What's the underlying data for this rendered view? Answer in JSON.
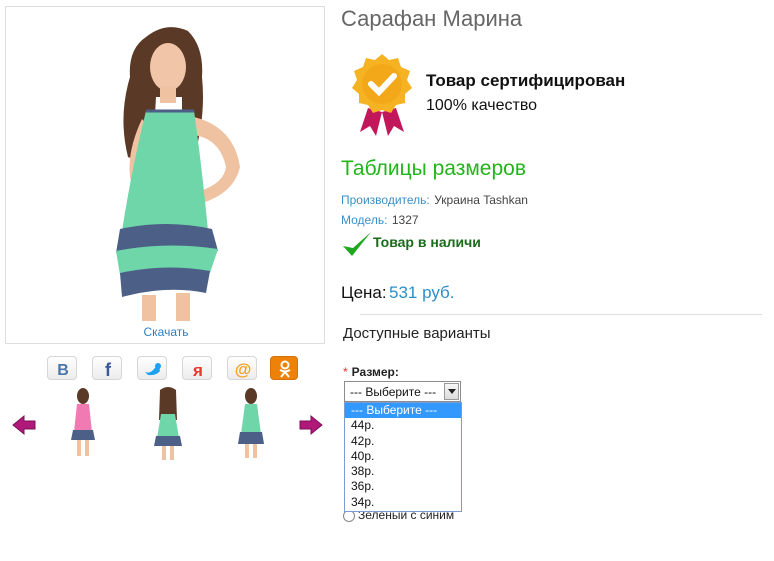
{
  "product": {
    "title": "Сарафан Марина",
    "download_label": "Скачать"
  },
  "certificate": {
    "title": "Товар сертифицирован",
    "subtitle": "100% качество",
    "icon": "certificate-badge-icon"
  },
  "size_table_link": "Таблицы размеров",
  "meta": {
    "manufacturer_label": "Производитель:",
    "manufacturer_value": "Украина Tashkan",
    "model_label": "Модель:",
    "model_value": "1327"
  },
  "stock": {
    "label": "Товар в наличи",
    "icon": "checkmark-icon",
    "color": "#1a6b1a"
  },
  "price": {
    "label": "Цена:",
    "value": "531 руб."
  },
  "variants": {
    "title": "Доступные варианты",
    "size_required_mark": "*",
    "size_label": "Размер:",
    "size_selected": "--- Выберите ---",
    "size_options": [
      "--- Выберите ---",
      "44р.",
      "42р.",
      "40р.",
      "38р.",
      "36р.",
      "34р."
    ],
    "color_option_partial": "Зеленый с синим"
  },
  "share": [
    {
      "name": "vk",
      "icon": "vk-icon",
      "color": "#4a76a8"
    },
    {
      "name": "facebook",
      "icon": "facebook-icon",
      "color": "#3b5998"
    },
    {
      "name": "twitter",
      "icon": "twitter-icon",
      "color": "#1da1f2"
    },
    {
      "name": "moimir",
      "icon": "moimir-icon",
      "color": "#e8372c"
    },
    {
      "name": "mail",
      "icon": "mail-at-icon",
      "color": "#f6a01a"
    },
    {
      "name": "odnoklassniki",
      "icon": "odnoklassniki-icon",
      "color": "#ee8208"
    }
  ],
  "colors": {
    "accent_green": "#22b51b",
    "link_blue": "#2c8fc7",
    "dress_mint": "#6fd6a9",
    "dress_ruffle": "#4c5f86",
    "arrow_purple": "#b0197a"
  }
}
